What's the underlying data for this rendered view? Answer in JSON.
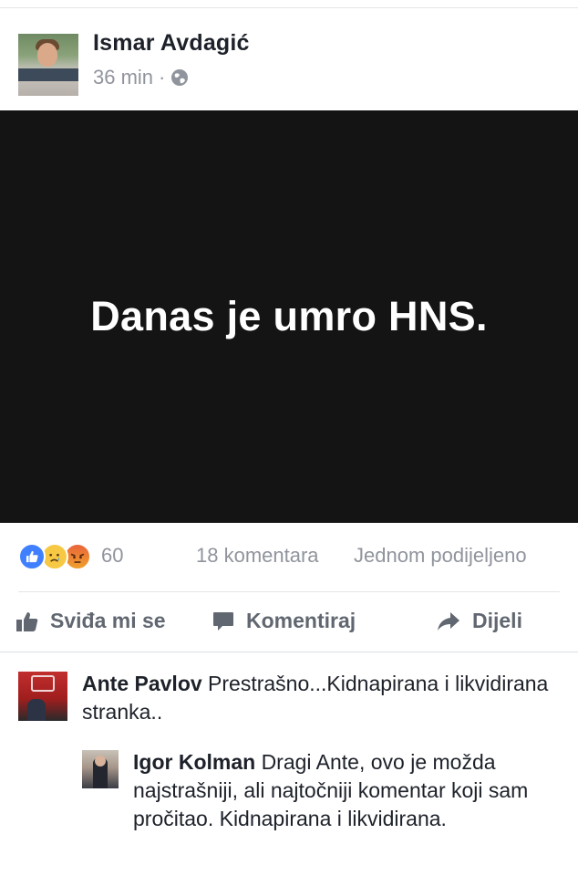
{
  "post": {
    "author": "Ismar Avdagić",
    "time": "36 min",
    "separator": "·",
    "privacy_icon": "globe-icon",
    "status_text": "Danas je umro HNS.",
    "status_background": "#141414"
  },
  "stats": {
    "reaction_icons": [
      "like-icon",
      "sad-icon",
      "angry-icon"
    ],
    "reaction_count": "60",
    "comments": "18 komentara",
    "shares": "Jednom podijeljeno"
  },
  "actions": {
    "like": "Sviđa mi se",
    "comment": "Komentiraj",
    "share": "Dijeli"
  },
  "comments": [
    {
      "name": "Ante Pavlov",
      "text": "Prestrašno...Kidnapirana i likvidirana stranka.."
    },
    {
      "name": "Igor Kolman",
      "text": "Dragi Ante, ovo je možda najstrašniji, ali najtočniji komentar koji sam pročitao. Kidnapirana i likvidirana."
    }
  ],
  "colors": {
    "name_text": "#1d2129",
    "secondary_text": "#90949c",
    "action_text": "#616770",
    "like_blue": "#4080ff"
  }
}
